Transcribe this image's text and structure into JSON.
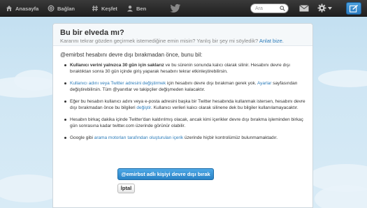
{
  "nav": {
    "home": "Anasayfa",
    "connect": "Bağlan",
    "discover": "Keşfet",
    "me": "Ben"
  },
  "search": {
    "placeholder": "Ara"
  },
  "card": {
    "title": "Bu bir elveda mı?",
    "subtitle": "Kararını tekrar gözden geçirmek istemediğine emin misin? Yanlış bir şey mi söyledik?",
    "subtitle_link": "Anlat bize.",
    "intro": "@emirbst hesabını devre dışı bırakmadan önce, bunu bil:",
    "b1_bold": "Kullanıcı verini yalnızca 30 gün için saklarız",
    "b1_rest": " ve bu sürenin sonunda kalıcı olarak silinir. Hesabını devre dışı bıraktıktan sonra 30 gün içinde giriş yaparak hesabını tekrar etkinleştirebilirsin.",
    "b2_link1": "Kullanıcı adını veya Twitter adresini değiştirmek",
    "b2_mid": " için hesabını devre dışı bırakman gerek yok. ",
    "b2_link2": "Ayarlar",
    "b2_rest": " sayfasından değiştirebilirsin. Tüm @yanıtlar ve takipçiler değişmeden kalacaktır.",
    "b3_text": "Eğer bu hesabın kullanıcı adını veya e-posta adresini başka bir Twitter hesabında kullanmak istersen, hesabını devre dışı bırakmadan önce bu bilgileri ",
    "b3_link": "değiştir",
    "b3_rest": ". Kullanıcı verileri kalıcı olarak silinene dek bu bilgiler kullanılamayacaktır.",
    "b4_text": "Hesabın birkaç dakika içinde Twitter'dan kaldırılmış olacak, ancak kimi içerikler devre dışı bırakma işleminden birkaç gün sonrasına kadar twitter.com üzerinde görünür olabilir.",
    "b5_pre": "Google gibi ",
    "b5_link": "arama motorları tarafından oluşturulan içerik",
    "b5_rest": " üzerinde hiçbir kontrolümüz bulunmamaktadır."
  },
  "actions": {
    "deactivate": "@emirbst adlı kişiyi devre dışı bırak",
    "cancel": "İptal"
  },
  "colors": {
    "link": "#2b7bb9",
    "primary": "#2a83c6",
    "topbar": "#2a2a2a"
  }
}
